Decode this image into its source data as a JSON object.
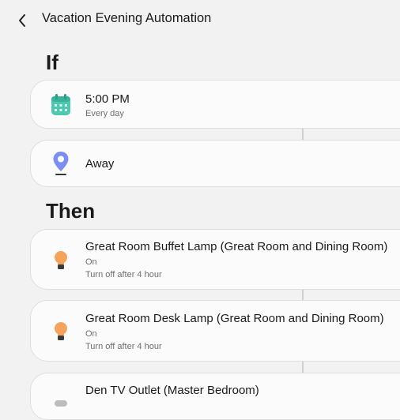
{
  "header": {
    "title": "Vacation Evening Automation"
  },
  "sections": {
    "if_title": "If",
    "then_title": "Then"
  },
  "conditions": [
    {
      "icon": "calendar-icon",
      "title": "5:00 PM",
      "subtitle": "Every day"
    },
    {
      "icon": "location-pin-icon",
      "title": "Away"
    }
  ],
  "actions": [
    {
      "icon": "bulb-icon",
      "title": "Great Room Buffet Lamp (Great Room and Dining Room)",
      "state": "On",
      "detail": "Turn off after 4 hour"
    },
    {
      "icon": "bulb-icon",
      "title": "Great Room Desk Lamp (Great Room and Dining Room)",
      "state": "On",
      "detail": "Turn off after 4 hour"
    },
    {
      "icon": "plug-icon",
      "title": "Den TV Outlet (Master Bedroom)"
    }
  ],
  "colors": {
    "background": "#f2f2f2",
    "card": "#fbfbfb",
    "calendar_accent": "#4cc9b0",
    "location_accent": "#7c8ef2",
    "bulb_accent": "#f5a35a"
  }
}
